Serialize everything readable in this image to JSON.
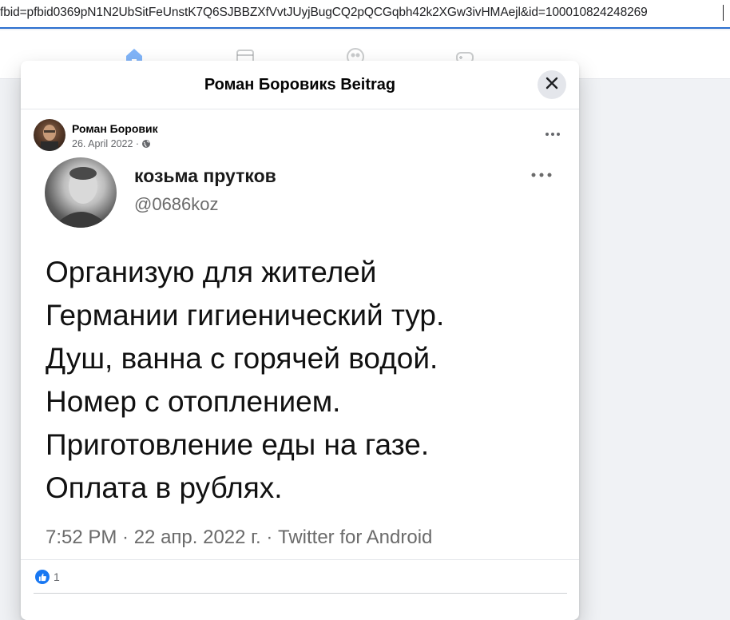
{
  "browser": {
    "url": "fbid=pfbid0369pN1N2UbSitFeUnstK7Q6SJBBZXfVvtJUyjBugCQ2pQCGqbh42k2XGw3ivHMAejl&id=100010824248269"
  },
  "nav": {
    "icons": [
      "home-icon",
      "marketplace-icon",
      "groups-icon",
      "gaming-icon"
    ],
    "active_color": "#1877f2"
  },
  "modal": {
    "title": "Роман Боровикs Beitrag",
    "close_icon": "close-icon"
  },
  "post": {
    "author": "Роман Боровик",
    "date": "26. April 2022 ·",
    "audience_icon": "globe-icon",
    "more_icon": "more-horizontal-icon"
  },
  "tweet": {
    "name": "козьма прутков",
    "handle": "@0686koz",
    "lines": [
      "Организую для жителей",
      "Германии гигиенический тур.",
      "Душ, ванна с горячей водой.",
      "Номер с отоплением.",
      "Приготовление еды на газе.",
      "Оплата в рублях."
    ],
    "footer": "7:52 PM · 22 апр. 2022 г. · Twitter for Android"
  },
  "reactions": {
    "icon": "like-icon",
    "count": "1",
    "color": "#1877f2"
  }
}
